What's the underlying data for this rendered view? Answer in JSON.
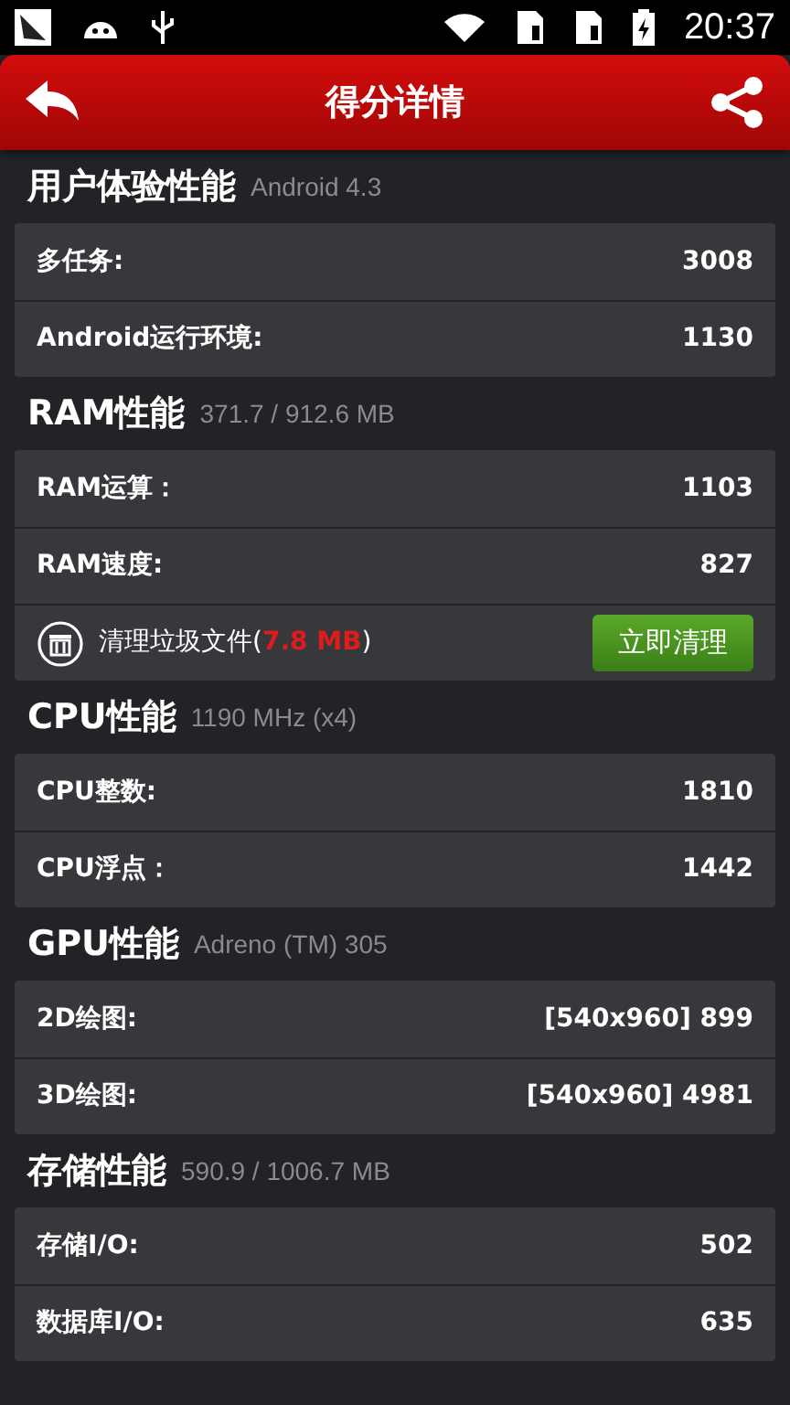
{
  "status_bar": {
    "time": "20:37"
  },
  "app_bar": {
    "title": "得分详情"
  },
  "sections": [
    {
      "title": "用户体验性能",
      "detail": "Android 4.3",
      "rows": [
        {
          "kind": "score",
          "label": "多任务:",
          "value": "3008"
        },
        {
          "kind": "score",
          "label": "Android运行环境:",
          "value": "1130"
        }
      ]
    },
    {
      "title": "RAM性能",
      "detail": "371.7 / 912.6 MB",
      "rows": [
        {
          "kind": "score",
          "label": "RAM运算：",
          "value": "1103"
        },
        {
          "kind": "score",
          "label": "RAM速度:",
          "value": "827"
        },
        {
          "kind": "cleanup",
          "label": "清理垃圾文件(",
          "size": "7.8 MB",
          "suffix": ")",
          "button": "立即清理"
        }
      ]
    },
    {
      "title": "CPU性能",
      "detail": "1190 MHz (x4)",
      "rows": [
        {
          "kind": "score",
          "label": "CPU整数:",
          "value": "1810"
        },
        {
          "kind": "score",
          "label": "CPU浮点：",
          "value": "1442"
        }
      ]
    },
    {
      "title": "GPU性能",
      "detail": "Adreno (TM) 305",
      "rows": [
        {
          "kind": "score",
          "label": "2D绘图:",
          "value": "[540x960] 899"
        },
        {
          "kind": "score",
          "label": "3D绘图:",
          "value": "[540x960] 4981"
        }
      ]
    },
    {
      "title": "存储性能",
      "detail": "590.9 / 1006.7 MB",
      "rows": [
        {
          "kind": "score",
          "label": "存储I/O:",
          "value": "502"
        },
        {
          "kind": "score",
          "label": "数据库I/O:",
          "value": "635"
        }
      ]
    }
  ]
}
